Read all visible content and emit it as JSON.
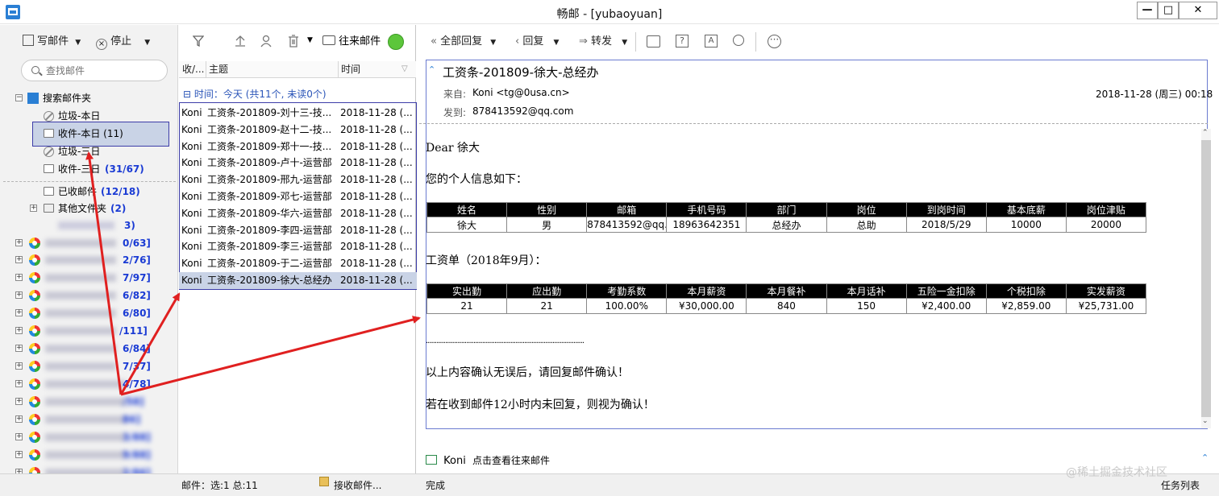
{
  "window": {
    "title": "畅邮 - [yubaoyuan]"
  },
  "left_toolbar": {
    "compose": "写邮件",
    "stop": "停止"
  },
  "search": {
    "placeholder": "查找邮件"
  },
  "folders": [
    {
      "label": "搜索邮件夹"
    },
    {
      "label": "垃圾-本日"
    },
    {
      "label": "收件-本日 (11)"
    },
    {
      "label": "垃圾-三日"
    },
    {
      "label": "收件-三日",
      "count": "(31/67)"
    },
    {
      "label": "已收邮件",
      "count": "(12/18)"
    },
    {
      "label": "其他文件夹",
      "count": "(2)"
    }
  ],
  "accounts_partial": [
    "3)",
    "0/63]",
    "2/76]",
    "7/97]",
    "6/82]",
    "6/80]",
    "/111]",
    "6/84]",
    "7/37]",
    "4/78]",
    "/58]",
    "86]",
    "3/88]",
    "9/88]",
    "2/86]",
    "1/84]"
  ],
  "mid_toolbar": {
    "contacts": "往来邮件"
  },
  "list_headers": {
    "col1": "收/...",
    "col2": "主题",
    "col3": "时间"
  },
  "group_header": "时间：今天 (共11个, 未读0个)",
  "mails": [
    {
      "from": "Koni",
      "subject": "工资条-201809-刘十三-技...",
      "time": "2018-11-28 (..."
    },
    {
      "from": "Koni",
      "subject": "工资条-201809-赵十二-技...",
      "time": "2018-11-28 (..."
    },
    {
      "from": "Koni",
      "subject": "工资条-201809-郑十一-技...",
      "time": "2018-11-28 (..."
    },
    {
      "from": "Koni",
      "subject": "工资条-201809-卢十-运营部",
      "time": "2018-11-28 (..."
    },
    {
      "from": "Koni",
      "subject": "工资条-201809-邢九-运营部",
      "time": "2018-11-28 (..."
    },
    {
      "from": "Koni",
      "subject": "工资条-201809-邓七-运营部",
      "time": "2018-11-28 (..."
    },
    {
      "from": "Koni",
      "subject": "工资条-201809-华六-运营部",
      "time": "2018-11-28 (..."
    },
    {
      "from": "Koni",
      "subject": "工资条-201809-李四-运营部",
      "time": "2018-11-28 (..."
    },
    {
      "from": "Koni",
      "subject": "工资条-201809-李三-运营部",
      "time": "2018-11-28 (..."
    },
    {
      "from": "Koni",
      "subject": "工资条-201809-于二-运营部",
      "time": "2018-11-28 (..."
    },
    {
      "from": "Koni",
      "subject": "工资条-201809-徐大-总经办",
      "time": "2018-11-28 (..."
    }
  ],
  "read_toolbar": {
    "reply_all": "全部回复",
    "reply": "回复",
    "forward": "转发"
  },
  "message": {
    "subject": "工资条-201809-徐大-总经办",
    "from_label": "来自:",
    "from_value": "Koni <tg@0usa.cn>",
    "to_label": "发到:",
    "to_value": "878413592@qq.com",
    "date": "2018-11-28 (周三) 00:18",
    "greeting": "Dear 徐大",
    "intro": "您的个人信息如下：",
    "info_headers": [
      "姓名",
      "性别",
      "邮箱",
      "手机号码",
      "部门",
      "岗位",
      "到岗时间",
      "基本底薪",
      "岗位津贴"
    ],
    "info_values": [
      "徐大",
      "男",
      "878413592@qq.c",
      "18963642351",
      "总经办",
      "总助",
      "2018/5/29",
      "10000",
      "20000"
    ],
    "pay_title": "工资单（2018年9月）：",
    "pay_headers": [
      "实出勤",
      "应出勤",
      "考勤系数",
      "本月薪资",
      "本月餐补",
      "本月话补",
      "五险一金扣除",
      "个税扣除",
      "实发薪资"
    ],
    "pay_values": [
      "21",
      "21",
      "100.00%",
      "¥30,000.00",
      "840",
      "150",
      "¥2,400.00",
      "¥2,859.00",
      "¥25,731.00"
    ],
    "separator": "..........................................................................................",
    "line1": "以上内容确认无误后，请回复邮件确认！",
    "line2": "若在收到邮件12小时内未回复，则视为确认！"
  },
  "contact_link": {
    "name": "Koni",
    "text": "点击查看往来邮件"
  },
  "status": {
    "selection": "邮件：选:1 总:11",
    "receiving": "接收邮件...",
    "done": "完成",
    "tasks": "任务列表"
  },
  "watermark": "@稀土掘金技术社区",
  "colors": {
    "selection": "#c9d3e6",
    "frame": "#6b7bd0",
    "arrow": "#e02020",
    "count_blue": "#1a3bd4"
  }
}
